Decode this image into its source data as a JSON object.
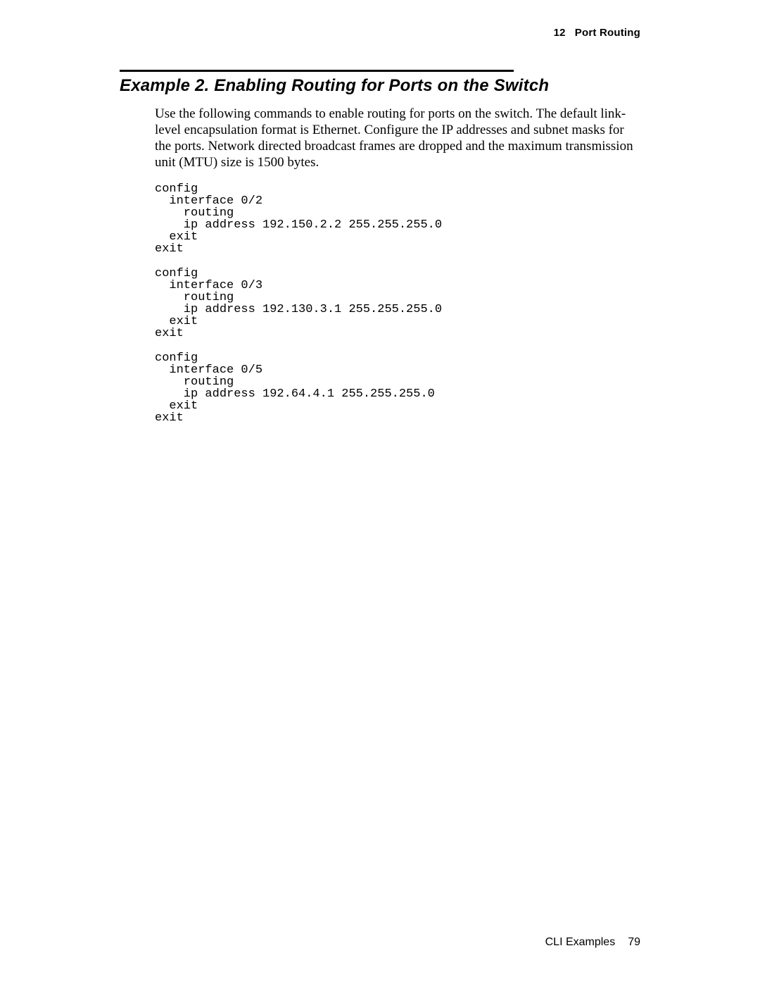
{
  "header": {
    "chapter_number": "12",
    "chapter_title": "Port Routing"
  },
  "section": {
    "title": "Example 2. Enabling Routing for Ports on the Switch",
    "paragraph": "Use the following commands to enable routing for ports on the switch. The default link-level encapsulation format is Ethernet. Configure the IP addresses and subnet masks for the ports. Network directed broadcast frames are dropped and the maximum transmission unit (MTU) size is 1500 bytes."
  },
  "code": {
    "block1": "config\n  interface 0/2\n    routing\n    ip address 192.150.2.2 255.255.255.0\n  exit\nexit",
    "block2": "config\n  interface 0/3\n    routing\n    ip address 192.130.3.1 255.255.255.0\n  exit\nexit",
    "block3": "config\n  interface 0/5\n    routing\n    ip address 192.64.4.1 255.255.255.0\n  exit\nexit"
  },
  "footer": {
    "label": "CLI Examples",
    "page": "79"
  }
}
